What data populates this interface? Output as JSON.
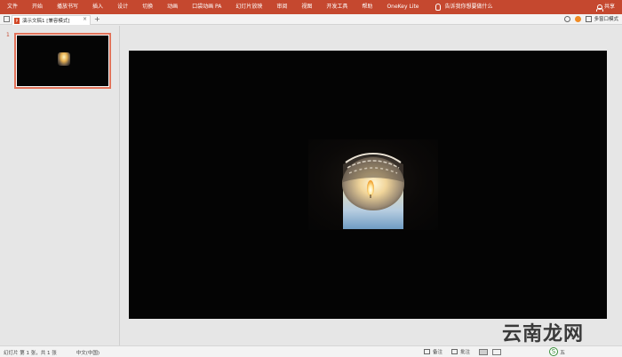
{
  "menubar": {
    "items": [
      "文件",
      "开始",
      "播放书写",
      "插入",
      "设计",
      "切换",
      "动画",
      "口袋动画 PA",
      "幻灯片放映",
      "审阅",
      "视图",
      "开发工具",
      "帮助",
      "OneKey Lite"
    ],
    "tell_me": "告诉我你想要做什么",
    "share": "共享",
    "color": "#c5482f"
  },
  "tabbar": {
    "doc_title": "演示文稿1 [兼容模式]",
    "close_glyph": "×",
    "add_glyph": "+",
    "multi_window": "多窗口模式"
  },
  "thumbnails": {
    "slide_number": "1"
  },
  "statusbar": {
    "slide_info": "幻灯片 第 1 张，共 1 张",
    "language": "中文(中国)",
    "notes": "备注",
    "comments": "批注"
  },
  "ime": {
    "mode": "五"
  },
  "watermark": "云南龙网"
}
